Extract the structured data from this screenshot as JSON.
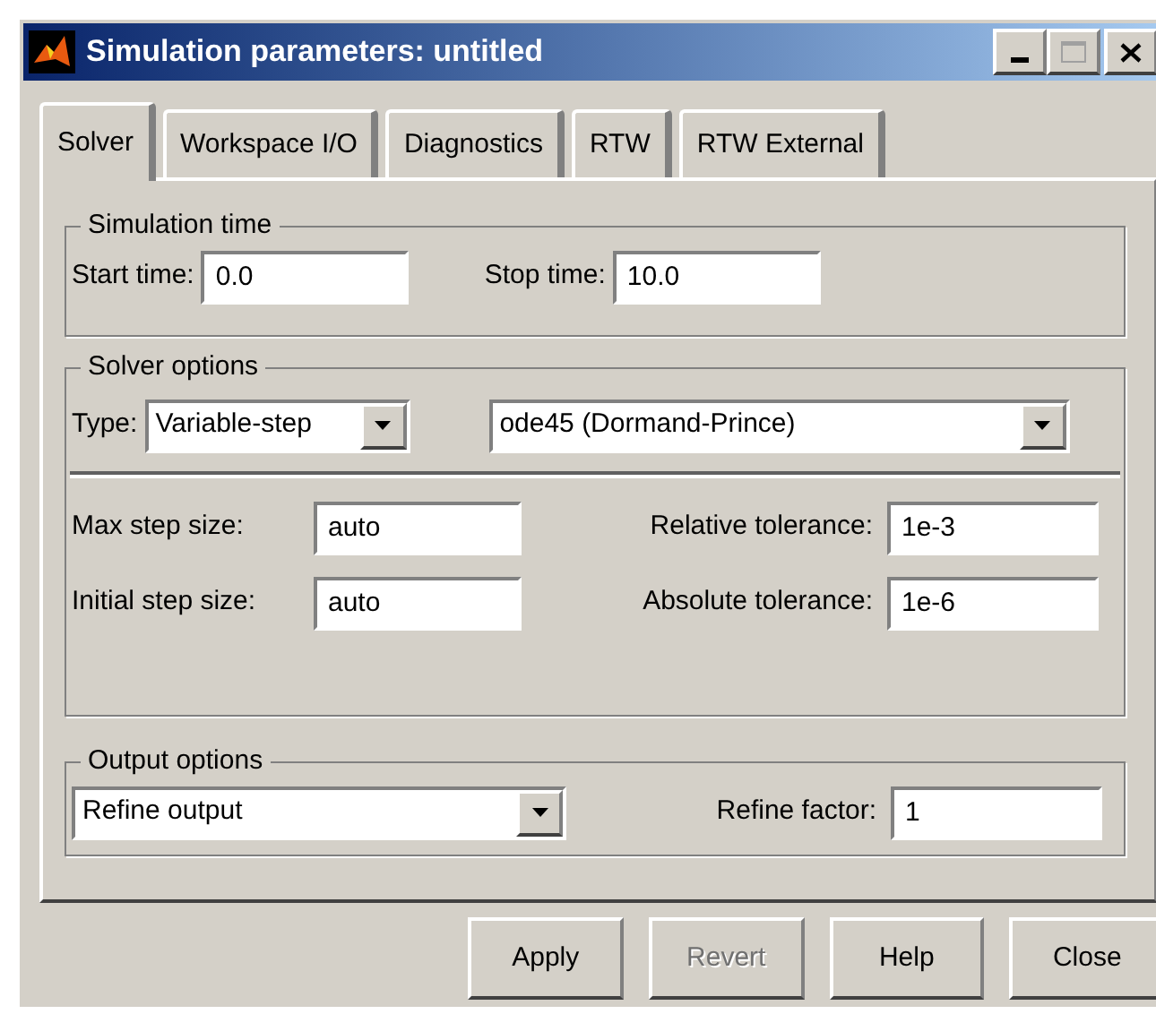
{
  "window": {
    "title": "Simulation parameters: untitled"
  },
  "tabs": [
    {
      "label": "Solver",
      "selected": true
    },
    {
      "label": "Workspace I/O",
      "selected": false
    },
    {
      "label": "Diagnostics",
      "selected": false
    },
    {
      "label": "RTW",
      "selected": false
    },
    {
      "label": "RTW External",
      "selected": false
    }
  ],
  "simulation_time": {
    "title": "Simulation time",
    "fields": [
      {
        "label": "Start time:",
        "value": "0.0"
      },
      {
        "label": "Stop time:",
        "value": "10.0"
      }
    ]
  },
  "solver_options": {
    "title": "Solver options",
    "type": {
      "label": "Type:",
      "value": "Variable-step"
    },
    "solver": {
      "value": "ode45 (Dormand-Prince)"
    },
    "fields": [
      {
        "label": "Max step size:",
        "value": "auto"
      },
      {
        "label": "Relative tolerance:",
        "value": "1e-3"
      },
      {
        "label": "Initial step size:",
        "value": "auto"
      },
      {
        "label": "Absolute tolerance:",
        "value": "1e-6"
      }
    ]
  },
  "output_options": {
    "title": "Output options",
    "option": {
      "value": "Refine output"
    },
    "refine_factor": {
      "label": "Refine factor:",
      "value": "1"
    }
  },
  "buttons": [
    {
      "label": "Apply",
      "disabled": false
    },
    {
      "label": "Revert",
      "disabled": true
    },
    {
      "label": "Help",
      "disabled": false
    },
    {
      "label": "Close",
      "disabled": false
    }
  ]
}
